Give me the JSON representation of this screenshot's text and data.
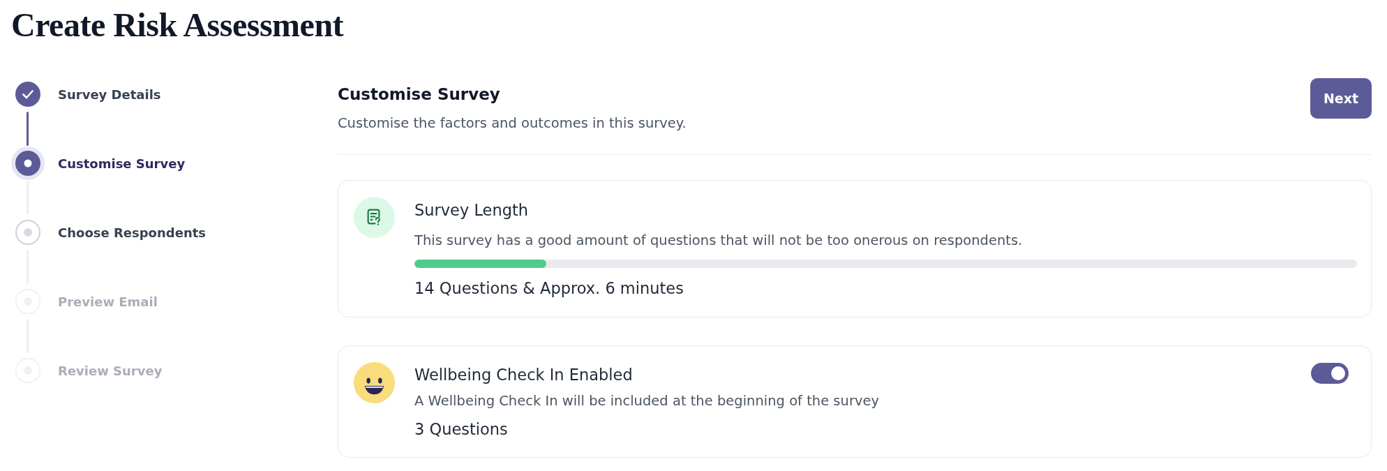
{
  "page": {
    "title": "Create Risk Assessment"
  },
  "steps": [
    {
      "label": "Survey Details",
      "completed": true,
      "selected": false,
      "disabled": false
    },
    {
      "label": "Customise Survey",
      "completed": false,
      "selected": true,
      "disabled": false
    },
    {
      "label": "Choose Respondents",
      "completed": false,
      "selected": false,
      "disabled": false
    },
    {
      "label": "Preview Email",
      "completed": false,
      "selected": false,
      "disabled": true
    },
    {
      "label": "Review Survey",
      "completed": false,
      "selected": false,
      "disabled": true
    }
  ],
  "section": {
    "title": "Customise Survey",
    "subtitle": "Customise the factors and outcomes in this survey.",
    "next_button": "Next"
  },
  "cards": [
    {
      "kind": "progress",
      "title": "Survey Length",
      "description": "This survey has a good amount of questions that will not be too onerous on respondents.",
      "level": 0.14,
      "summary": "14 Questions & Approx. 6 minutes"
    },
    {
      "kind": "toggle",
      "title": "Wellbeing Check In Enabled",
      "description": "A Wellbeing Check In will be included at the beginning of the survey",
      "on": true,
      "summary": "3 Questions"
    }
  ]
}
